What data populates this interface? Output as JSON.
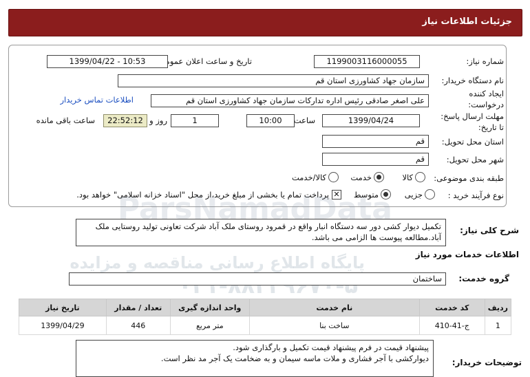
{
  "header": {
    "title": "جزئیات اطلاعات نیاز"
  },
  "form": {
    "need_number_label": "شماره نیاز:",
    "need_number": "1199003116000055",
    "announce_label": "تاریخ و ساعت اعلان عمومی:",
    "announce_value": "1399/04/22 - 10:53",
    "buyer_label": "نام دستگاه خریدار:",
    "buyer_value": "سازمان جهاد کشاورزی استان قم",
    "creator_label_1": "ایجاد کننده",
    "creator_label_2": "درخواست:",
    "creator_value": "علی اصغر صادقی رئیس اداره تدارکات سازمان جهاد کشاورزی استان قم",
    "contact_link": "اطلاعات تماس خریدار",
    "deadline_label_1": "مهلت ارسال پاسخ:",
    "deadline_label_2": "تا تاریخ:",
    "deadline_date": "1399/04/24",
    "time_label": "ساعت",
    "deadline_time": "10:00",
    "days_value": "1",
    "days_label": "روز و",
    "remaining_time": "22:52:12",
    "remaining_label": "ساعت باقی مانده",
    "province_label": "استان محل تحویل:",
    "province_value": "قم",
    "city_label": "شهر محل تحویل:",
    "city_value": "قم",
    "category_label": "طبقه بندی موضوعی:",
    "category_options": [
      "کالا",
      "خدمت",
      "کالا/خدمت"
    ],
    "category_selected": "خدمت",
    "process_label": "نوع فرآیند خرید :",
    "process_options": [
      "جزیی",
      "متوسط"
    ],
    "process_selected": "متوسط",
    "payment_note": "پرداخت تمام یا بخشی از مبلغ خرید،از محل \"اسناد خزانه اسلامی\" خواهد بود.",
    "payment_checked": true
  },
  "summary": {
    "label": "شرح کلی نیاز:",
    "text_line1": "تکمیل دیوار کشی دور سه دستگاه انبار واقع در قمرود روستای ملک آباد شرکت تعاونی تولید روستایی ملک",
    "text_line2": "آباد.مطالعه پیوست ها الزامی می باشد."
  },
  "services": {
    "section_title": "اطلاعات خدمات مورد نیاز",
    "group_label": "گروه خدمت:",
    "group_value": "ساختمان",
    "columns": [
      "ردیف",
      "کد خدمت",
      "نام خدمت",
      "واحد اندازه گیری",
      "تعداد / مقدار",
      "تاریخ نیاز"
    ],
    "rows": [
      {
        "row": "1",
        "code": "ج-41-410",
        "name": "ساخت بنا",
        "unit": "متر مربع",
        "qty": "446",
        "date": "1399/04/29"
      }
    ]
  },
  "buyer_notes": {
    "label": "توضیحات خریدار:",
    "line1": "پیشنهاد قیمت در فرم پیشنهاد قیمت تکمیل و بارگذاری شود.",
    "line2": "دیوارکشی با آجر فشاری و ملات ماسه سیمان و به ضخامت یک آجر مد نظر است."
  },
  "watermark": {
    "brand": "ParsNamadData",
    "line1": "پایگاه اطلاع رسانی مناقصه و مزایده",
    "phone": "۰۲۱-۸۸۳۴۹۶۷۰-۵"
  }
}
